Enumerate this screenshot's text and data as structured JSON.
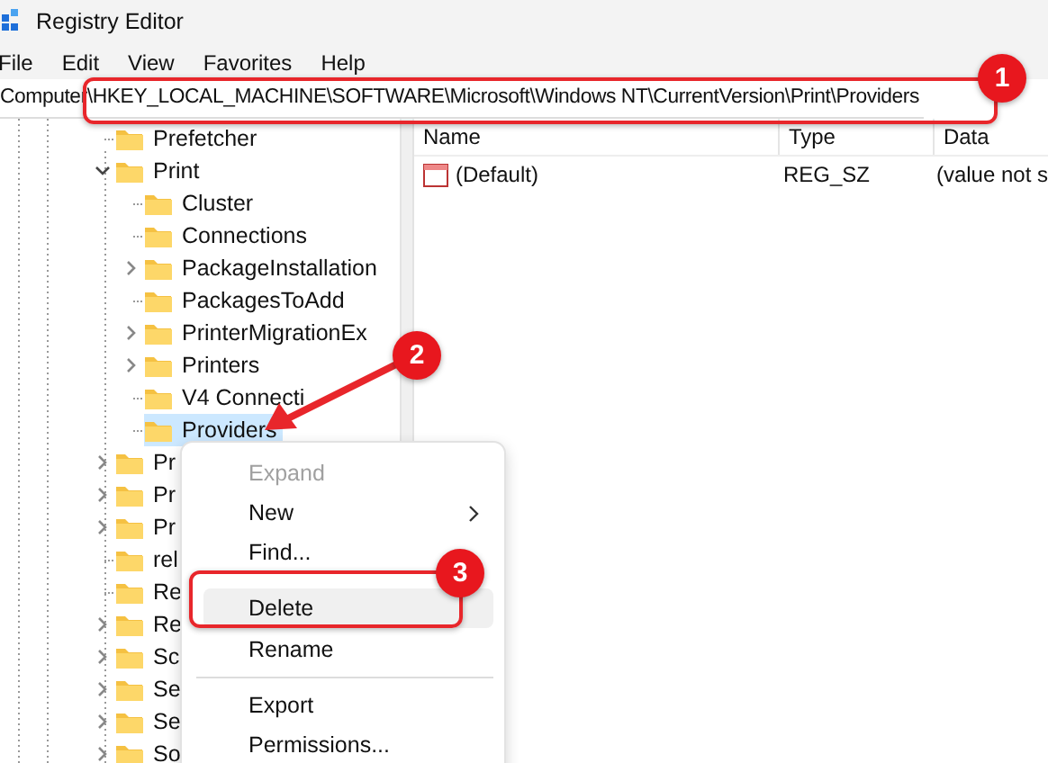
{
  "window": {
    "title": "Registry Editor"
  },
  "menu_bar": [
    "File",
    "Edit",
    "View",
    "Favorites",
    "Help"
  ],
  "address_bar": {
    "value": "Computer\\HKEY_LOCAL_MACHINE\\SOFTWARE\\Microsoft\\Windows NT\\CurrentVersion\\Print\\Providers"
  },
  "tree": [
    {
      "label": "Prefetcher",
      "has_children": false,
      "expanded": false,
      "selected": false
    },
    {
      "label": "Print",
      "has_children": true,
      "expanded": true,
      "selected": false,
      "children": [
        {
          "label": "Cluster",
          "has_children": false,
          "expanded": false,
          "selected": false
        },
        {
          "label": "Connections",
          "has_children": false,
          "expanded": false,
          "selected": false
        },
        {
          "label": "PackageInstallation",
          "has_children": true,
          "expanded": false,
          "selected": false
        },
        {
          "label": "PackagesToAdd",
          "has_children": false,
          "expanded": false,
          "selected": false
        },
        {
          "label": "PrinterMigrationEx",
          "has_children": true,
          "expanded": false,
          "selected": false
        },
        {
          "label": "Printers",
          "has_children": true,
          "expanded": false,
          "selected": false
        },
        {
          "label": "V4 Connecti",
          "has_children": false,
          "expanded": false,
          "selected": false
        },
        {
          "label": "Providers",
          "has_children": false,
          "expanded": false,
          "selected": true
        }
      ]
    },
    {
      "label": "Pr",
      "has_children": true,
      "expanded": false,
      "selected": false
    },
    {
      "label": "Pr",
      "has_children": true,
      "expanded": false,
      "selected": false
    },
    {
      "label": "Pr",
      "has_children": true,
      "expanded": false,
      "selected": false
    },
    {
      "label": "rel",
      "has_children": false,
      "expanded": false,
      "selected": false
    },
    {
      "label": "Re",
      "has_children": false,
      "expanded": false,
      "selected": false
    },
    {
      "label": "Re",
      "has_children": true,
      "expanded": false,
      "selected": false
    },
    {
      "label": "Sc",
      "has_children": true,
      "expanded": false,
      "selected": false
    },
    {
      "label": "Se",
      "has_children": true,
      "expanded": false,
      "selected": false
    },
    {
      "label": "Se",
      "has_children": true,
      "expanded": false,
      "selected": false
    },
    {
      "label": "So",
      "has_children": true,
      "expanded": false,
      "selected": false
    }
  ],
  "table": {
    "columns": [
      "Name",
      "Type",
      "Data"
    ],
    "rows": [
      {
        "name": "(Default)",
        "type": "REG_SZ",
        "data": "(value not s"
      }
    ]
  },
  "context_menu": [
    {
      "kind": "item",
      "label": "Expand",
      "disabled": true,
      "submenu": false,
      "highlighted": false
    },
    {
      "kind": "item",
      "label": "New",
      "disabled": false,
      "submenu": true,
      "highlighted": false
    },
    {
      "kind": "item",
      "label": "Find...",
      "disabled": false,
      "submenu": false,
      "highlighted": false
    },
    {
      "kind": "item",
      "label": "Delete",
      "disabled": false,
      "submenu": false,
      "highlighted": true
    },
    {
      "kind": "item",
      "label": "Rename",
      "disabled": false,
      "submenu": false,
      "highlighted": false
    },
    {
      "kind": "separator"
    },
    {
      "kind": "item",
      "label": "Export",
      "disabled": false,
      "submenu": false,
      "highlighted": false
    },
    {
      "kind": "item",
      "label": "Permissions...",
      "disabled": false,
      "submenu": false,
      "highlighted": false
    }
  ],
  "callouts": [
    {
      "number": "1"
    },
    {
      "number": "2"
    },
    {
      "number": "3"
    }
  ]
}
